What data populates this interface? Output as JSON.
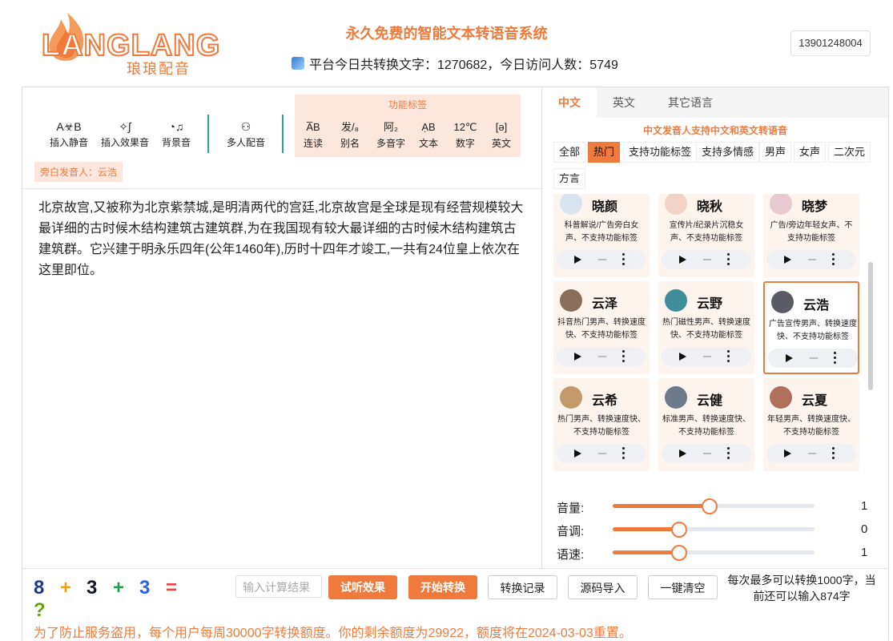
{
  "brand": {
    "logo_text": "LANGLANG",
    "logo_cn": "琅琅配音"
  },
  "site": {
    "title": "永久免费的智能文本转语音系统",
    "stats": "平台今日共转换文字：1270682，今日访问人数：5749"
  },
  "user": {
    "phone": "13901248004"
  },
  "toolbar": {
    "tools": [
      "插入静音",
      "插入效果音",
      "背景音",
      "多人配音"
    ],
    "tool_icons": [
      "A☣B",
      "✧∫",
      "◔♫",
      "⚇"
    ],
    "func_caption": "功能标签",
    "func_items": [
      "连读",
      "别名",
      "多音字",
      "文本",
      "数字",
      "英文"
    ],
    "func_icons": [
      "A̅B",
      "发/₈",
      "阿₂",
      "ẠB",
      "12℃",
      "[ə]"
    ],
    "narrator": "旁白发音人：云浩"
  },
  "editor": {
    "text": "北京故宫,又被称为北京紫禁城,是明清两代的宫廷,北京故宫是全球是现有经营规模较大最详细的古时候木结构建筑古建筑群,为在我国现有较大最详细的古时候木结构建筑古建筑群。它兴建于明永乐四年(公年1460年),历时十四年才竣工,一共有24位皇上依次在这里即位。"
  },
  "lang_tabs": [
    "中文",
    "英文",
    "其它语言"
  ],
  "voice_caption": "中文发音人支持中文和英文转语音",
  "filters": [
    "全部",
    "热门",
    "支持功能标签",
    "支持多情感",
    "男声",
    "女声",
    "二次元",
    "方言"
  ],
  "voices": [
    {
      "name": "晓颜",
      "desc": "科普解说/广告旁白女声、不支持功能标签"
    },
    {
      "name": "晓秋",
      "desc": "宣传片/纪录片沉稳女声、不支持功能标签"
    },
    {
      "name": "晓梦",
      "desc": "广告/旁边年轻女声、不支持功能标签"
    },
    {
      "name": "云泽",
      "desc": "抖音热门男声、转换速度快、不支持功能标签"
    },
    {
      "name": "云野",
      "desc": "热门磁性男声、转换速度快、不支持功能标签"
    },
    {
      "name": "云浩",
      "desc": "广告宣传男声、转换速度快、不支持功能标签"
    },
    {
      "name": "云希",
      "desc": "热门男声、转换速度快、不支持功能标签"
    },
    {
      "name": "云健",
      "desc": "标准男声、转换速度快、不支持功能标签"
    },
    {
      "name": "云夏",
      "desc": "年轻男声、转换速度快、不支持功能标签"
    }
  ],
  "sliders": [
    {
      "label": "音量:",
      "value": "1",
      "fraction": 0.48
    },
    {
      "label": "音调:",
      "value": "0",
      "fraction": 0.33
    },
    {
      "label": "语速:",
      "value": "1",
      "fraction": 0.33
    }
  ],
  "captcha": "8+3+3=?",
  "calc_placeholder": "输入计算结果",
  "buttons": {
    "preview": "试听效果",
    "convert": "开始转换",
    "history": "转换记录",
    "import": "源码导入",
    "clear": "一键清空"
  },
  "limit": "每次最多可以转换1000字，当前还可以输入874字",
  "notice": "为了防止服务盗用，每个用户每周30000字转换额度。你的剩余额度为29922，额度将在2024-03-03重置。",
  "colors": {
    "accent": "#ef7a3b",
    "accent_light": "#fde7dc",
    "divider": "#2aa58e"
  }
}
